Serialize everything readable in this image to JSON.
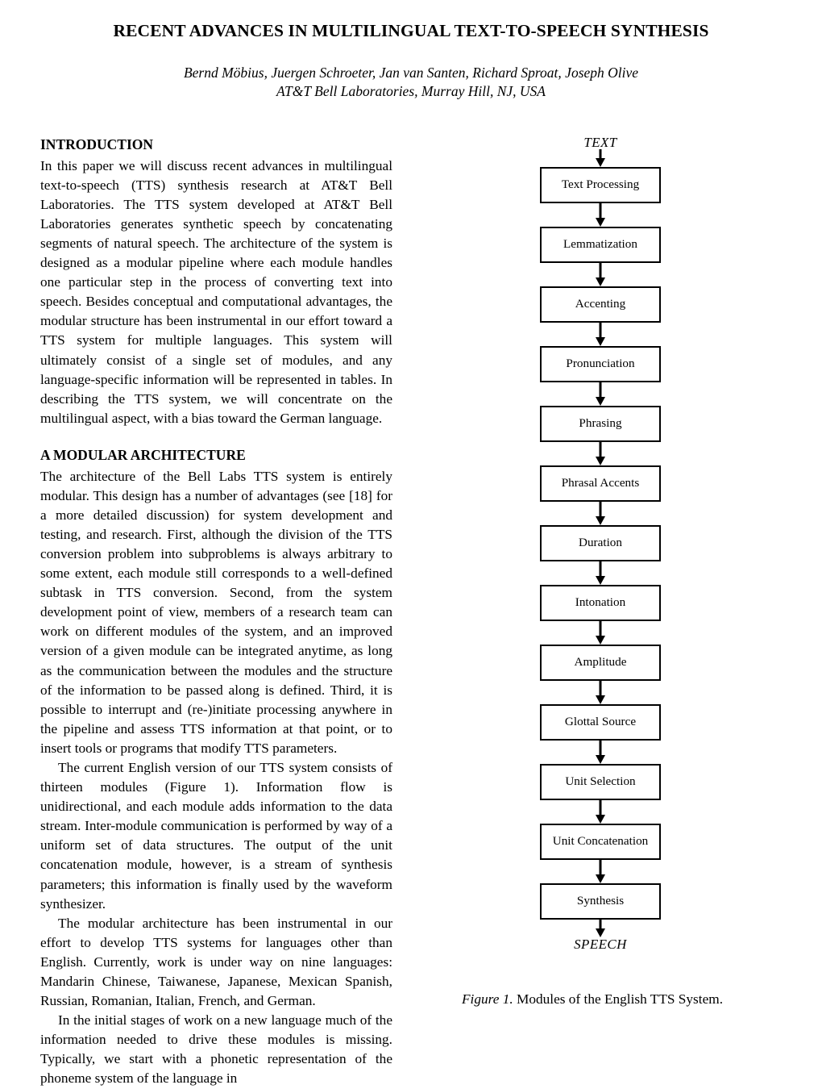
{
  "paper": {
    "title": "RECENT ADVANCES IN MULTILINGUAL TEXT-TO-SPEECH SYNTHESIS",
    "authors": "Bernd Möbius, Juergen Schroeter, Jan van Santen, Richard Sproat, Joseph Olive",
    "affiliation": "AT&T Bell Laboratories, Murray Hill, NJ, USA"
  },
  "sections": {
    "introduction": {
      "heading": "INTRODUCTION",
      "paragraphs": [
        "In this paper we will discuss recent advances in multilingual text-to-speech (TTS) synthesis research at AT&T Bell Laboratories. The TTS system developed at AT&T Bell Laboratories generates synthetic speech by concatenating segments of natural speech. The architecture of the system is designed as a modular pipeline where each module handles one particular step in the process of converting text into speech. Besides conceptual and computational advantages, the modular structure has been instrumental in our effort toward a TTS system for multiple languages. This system will ultimately consist of a single set of modules, and any language-specific information will be represented in tables. In describing the TTS system, we will concentrate on the multilingual aspect, with a bias toward the German language."
      ]
    },
    "modular_architecture": {
      "heading": "A MODULAR ARCHITECTURE",
      "paragraphs": [
        "The architecture of the Bell Labs TTS system is entirely modular. This design has a number of advantages (see [18] for a more detailed discussion) for system development and testing, and research. First, although the division of the TTS conversion problem into subproblems is always arbitrary to some extent, each module still corresponds to a well-defined subtask in TTS conversion. Second, from the system development point of view, members of a research team can work on different modules of the system, and an improved version of a given module can be integrated anytime, as long as the communication between the modules and the structure of the information to be passed along is defined. Third, it is possible to interrupt and (re-)initiate processing anywhere in the pipeline and assess TTS information at that point, or to insert tools or programs that modify TTS parameters.",
        "The current English version of our TTS system consists of thirteen modules (Figure 1). Information flow is unidirectional, and each module adds information to the data stream. Inter-module communication is performed by way of a uniform set of data structures. The output of the unit concatenation module, however, is a stream of synthesis parameters; this information is finally used by the waveform synthesizer.",
        "The modular architecture has been instrumental in our effort to develop TTS systems for languages other than English. Currently, work is under way on nine languages: Mandarin Chinese, Taiwanese, Japanese, Mexican Spanish, Russian, Romanian, Italian, French, and German.",
        "In the initial stages of work on a new language much of the information needed to drive these modules is missing. Typically, we start with a phonetic representation of the phoneme system of the language in"
      ]
    }
  },
  "figure": {
    "input_label": "TEXT",
    "output_label": "SPEECH",
    "caption_number": "Figure 1.",
    "caption_text": " Modules of the English TTS System.",
    "modules": [
      {
        "label": "Text Processing"
      },
      {
        "label": "Lemmatization"
      },
      {
        "label": "Accenting"
      },
      {
        "label": "Pronunciation"
      },
      {
        "label": "Phrasing"
      },
      {
        "label": "Phrasal Accents"
      },
      {
        "label": "Duration"
      },
      {
        "label": "Intonation"
      },
      {
        "label": "Amplitude"
      },
      {
        "label": "Glottal Source"
      },
      {
        "label": "Unit Selection"
      },
      {
        "label": "Unit Concatenation"
      },
      {
        "label": "Synthesis"
      }
    ]
  }
}
